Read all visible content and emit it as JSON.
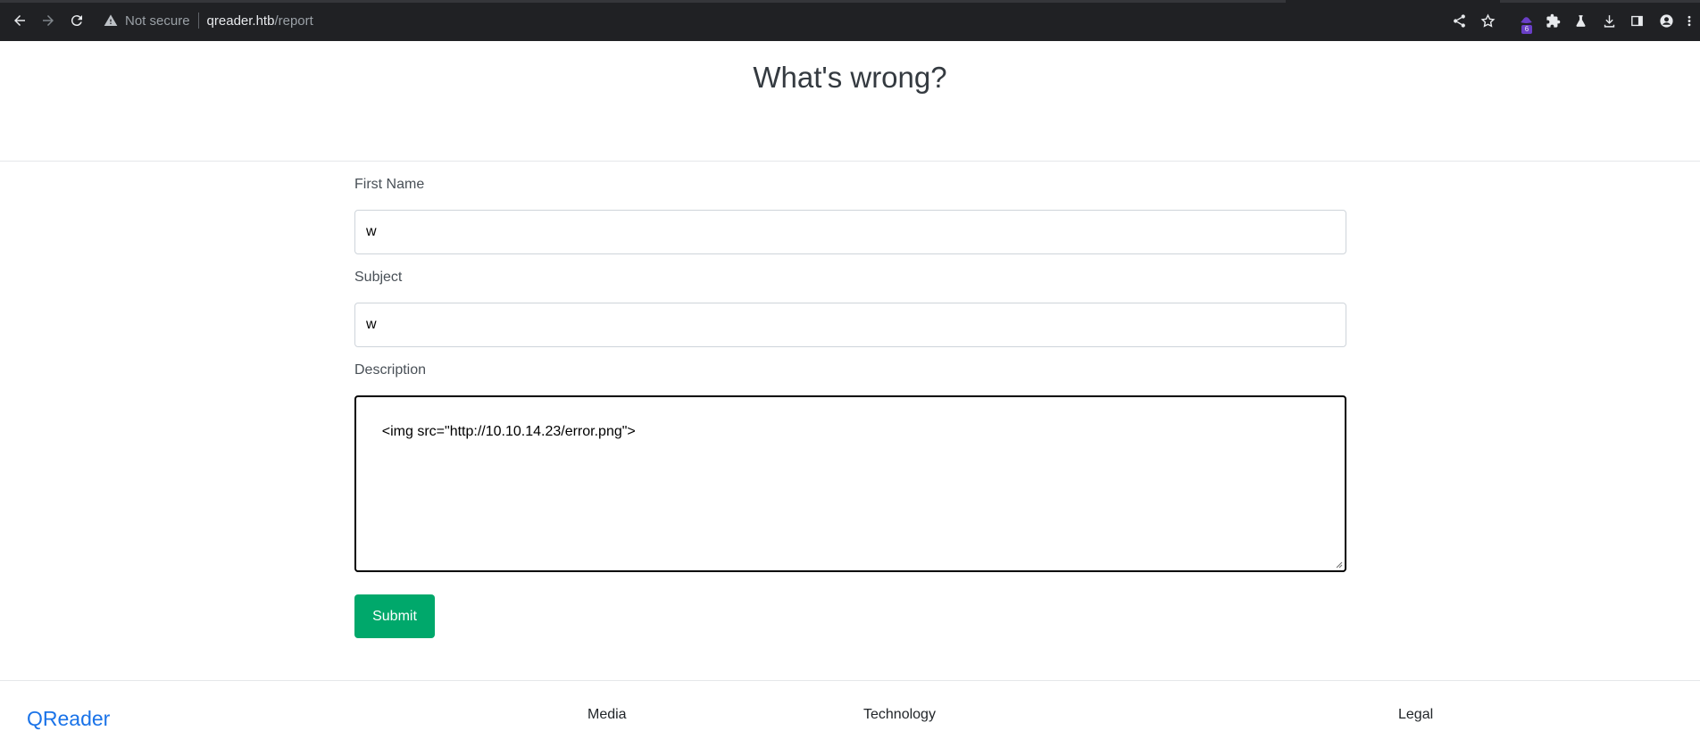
{
  "browser": {
    "security_label": "Not secure",
    "url_host": "qreader.htb",
    "url_path": "/report",
    "extension_badge": "6"
  },
  "page": {
    "title": "What's wrong?"
  },
  "form": {
    "first_name_label": "First Name",
    "first_name_value": "w",
    "subject_label": "Subject",
    "subject_value": "w",
    "description_label": "Description",
    "description_value": "<img src=\"http://10.10.14.23/error.png\">",
    "submit_label": "Submit"
  },
  "footer": {
    "brand": "QReader",
    "columns": [
      "Media",
      "Technology",
      "Legal"
    ]
  },
  "colors": {
    "chrome_bg": "#202124",
    "submit_bg": "#00a86b",
    "brand_blue": "#1a73e8"
  }
}
